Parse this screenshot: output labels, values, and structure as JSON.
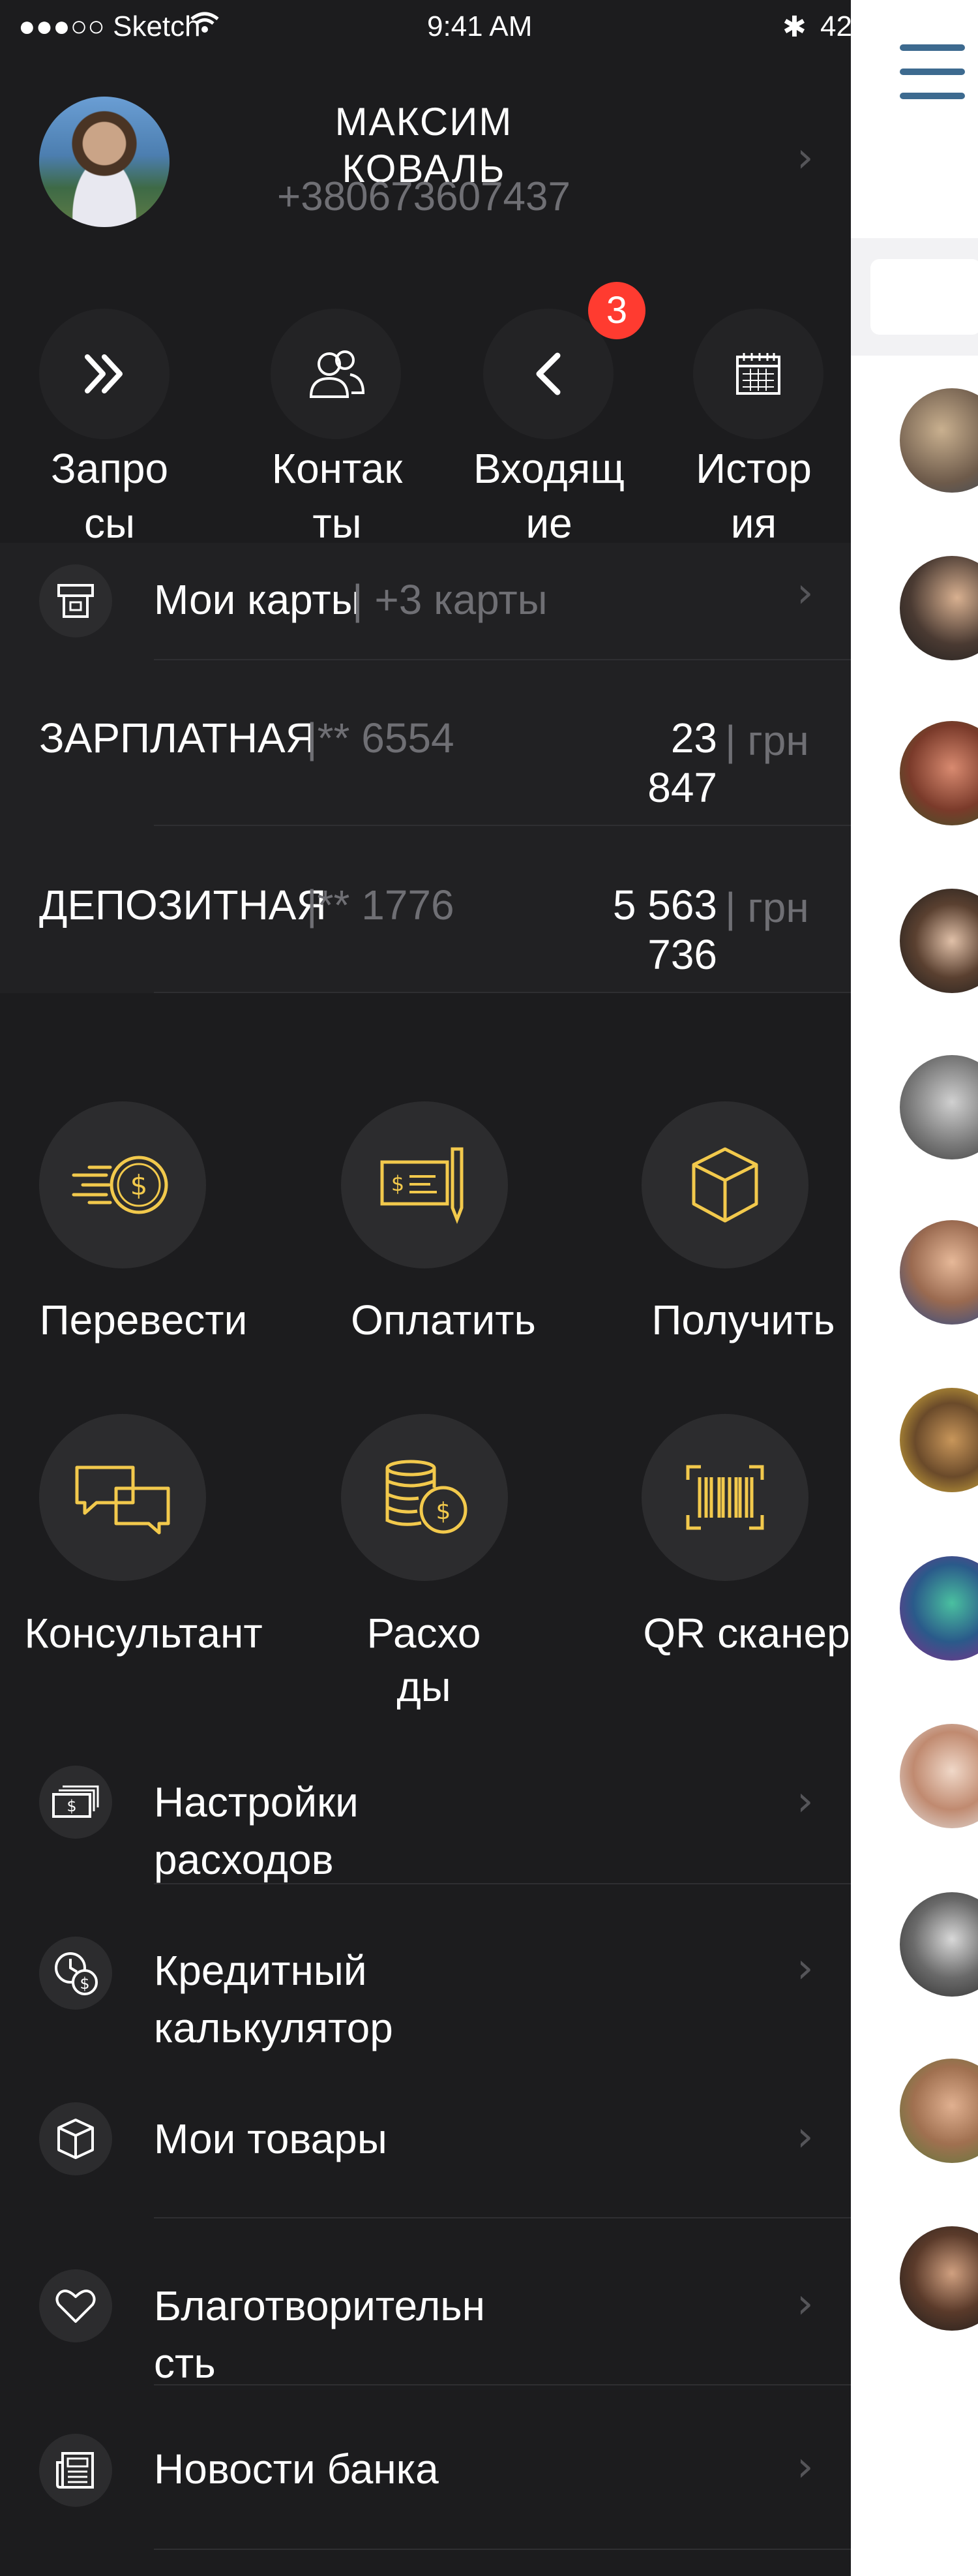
{
  "status": {
    "carrier": "●●●○○ Sketch",
    "time": "9:41 AM",
    "battery": "42"
  },
  "profile": {
    "first_name": "МАКСИМ",
    "last_name": "КОВАЛЬ",
    "phone": "+380673607437"
  },
  "quick_actions": {
    "requests": {
      "line1": "Запро",
      "line2": "сы",
      "icon": "double-chevron-right-icon"
    },
    "contacts": {
      "line1": "Контак",
      "line2": "ты",
      "icon": "contacts-icon"
    },
    "incoming": {
      "line1": "Входящ",
      "line2": "ие",
      "icon": "chevron-left-icon",
      "badge": "3"
    },
    "history": {
      "line1": "Истор",
      "line2": "ия",
      "icon": "calendar-icon"
    }
  },
  "my_cards": {
    "label": "Мои карты",
    "extra": "| +3 карты"
  },
  "cards": [
    {
      "name": "ЗАРПЛАТНАЯ",
      "mask": "|** 6554",
      "amount_line1": "23",
      "amount_line2": "847",
      "currency": "| грн"
    },
    {
      "name": "ДЕПОЗИТНАЯ",
      "mask": "|** 1776",
      "amount_line1": "5 563",
      "amount_line2": "736",
      "currency": "| грн"
    }
  ],
  "actions": {
    "transfer": "Перевести",
    "pay": "Оплатить",
    "receive": "Получить",
    "consultant": "Консультант",
    "expenses_line1": "Расхо",
    "expenses_line2": "ды",
    "qr": "QR сканер"
  },
  "menu": {
    "settings_line1": "Настройки",
    "settings_line2": "расходов",
    "credit_line1": "Кредитный",
    "credit_line2": "калькулятор",
    "goods": "Мои товары",
    "charity_line1": "Благотворительн",
    "charity_line2": "сть",
    "news": "Новости банка"
  },
  "colors": {
    "accent": "#f2c94c",
    "background": "#1c1c1e",
    "badge": "#ff3b30",
    "menu_icon": "#3d6a8f"
  }
}
